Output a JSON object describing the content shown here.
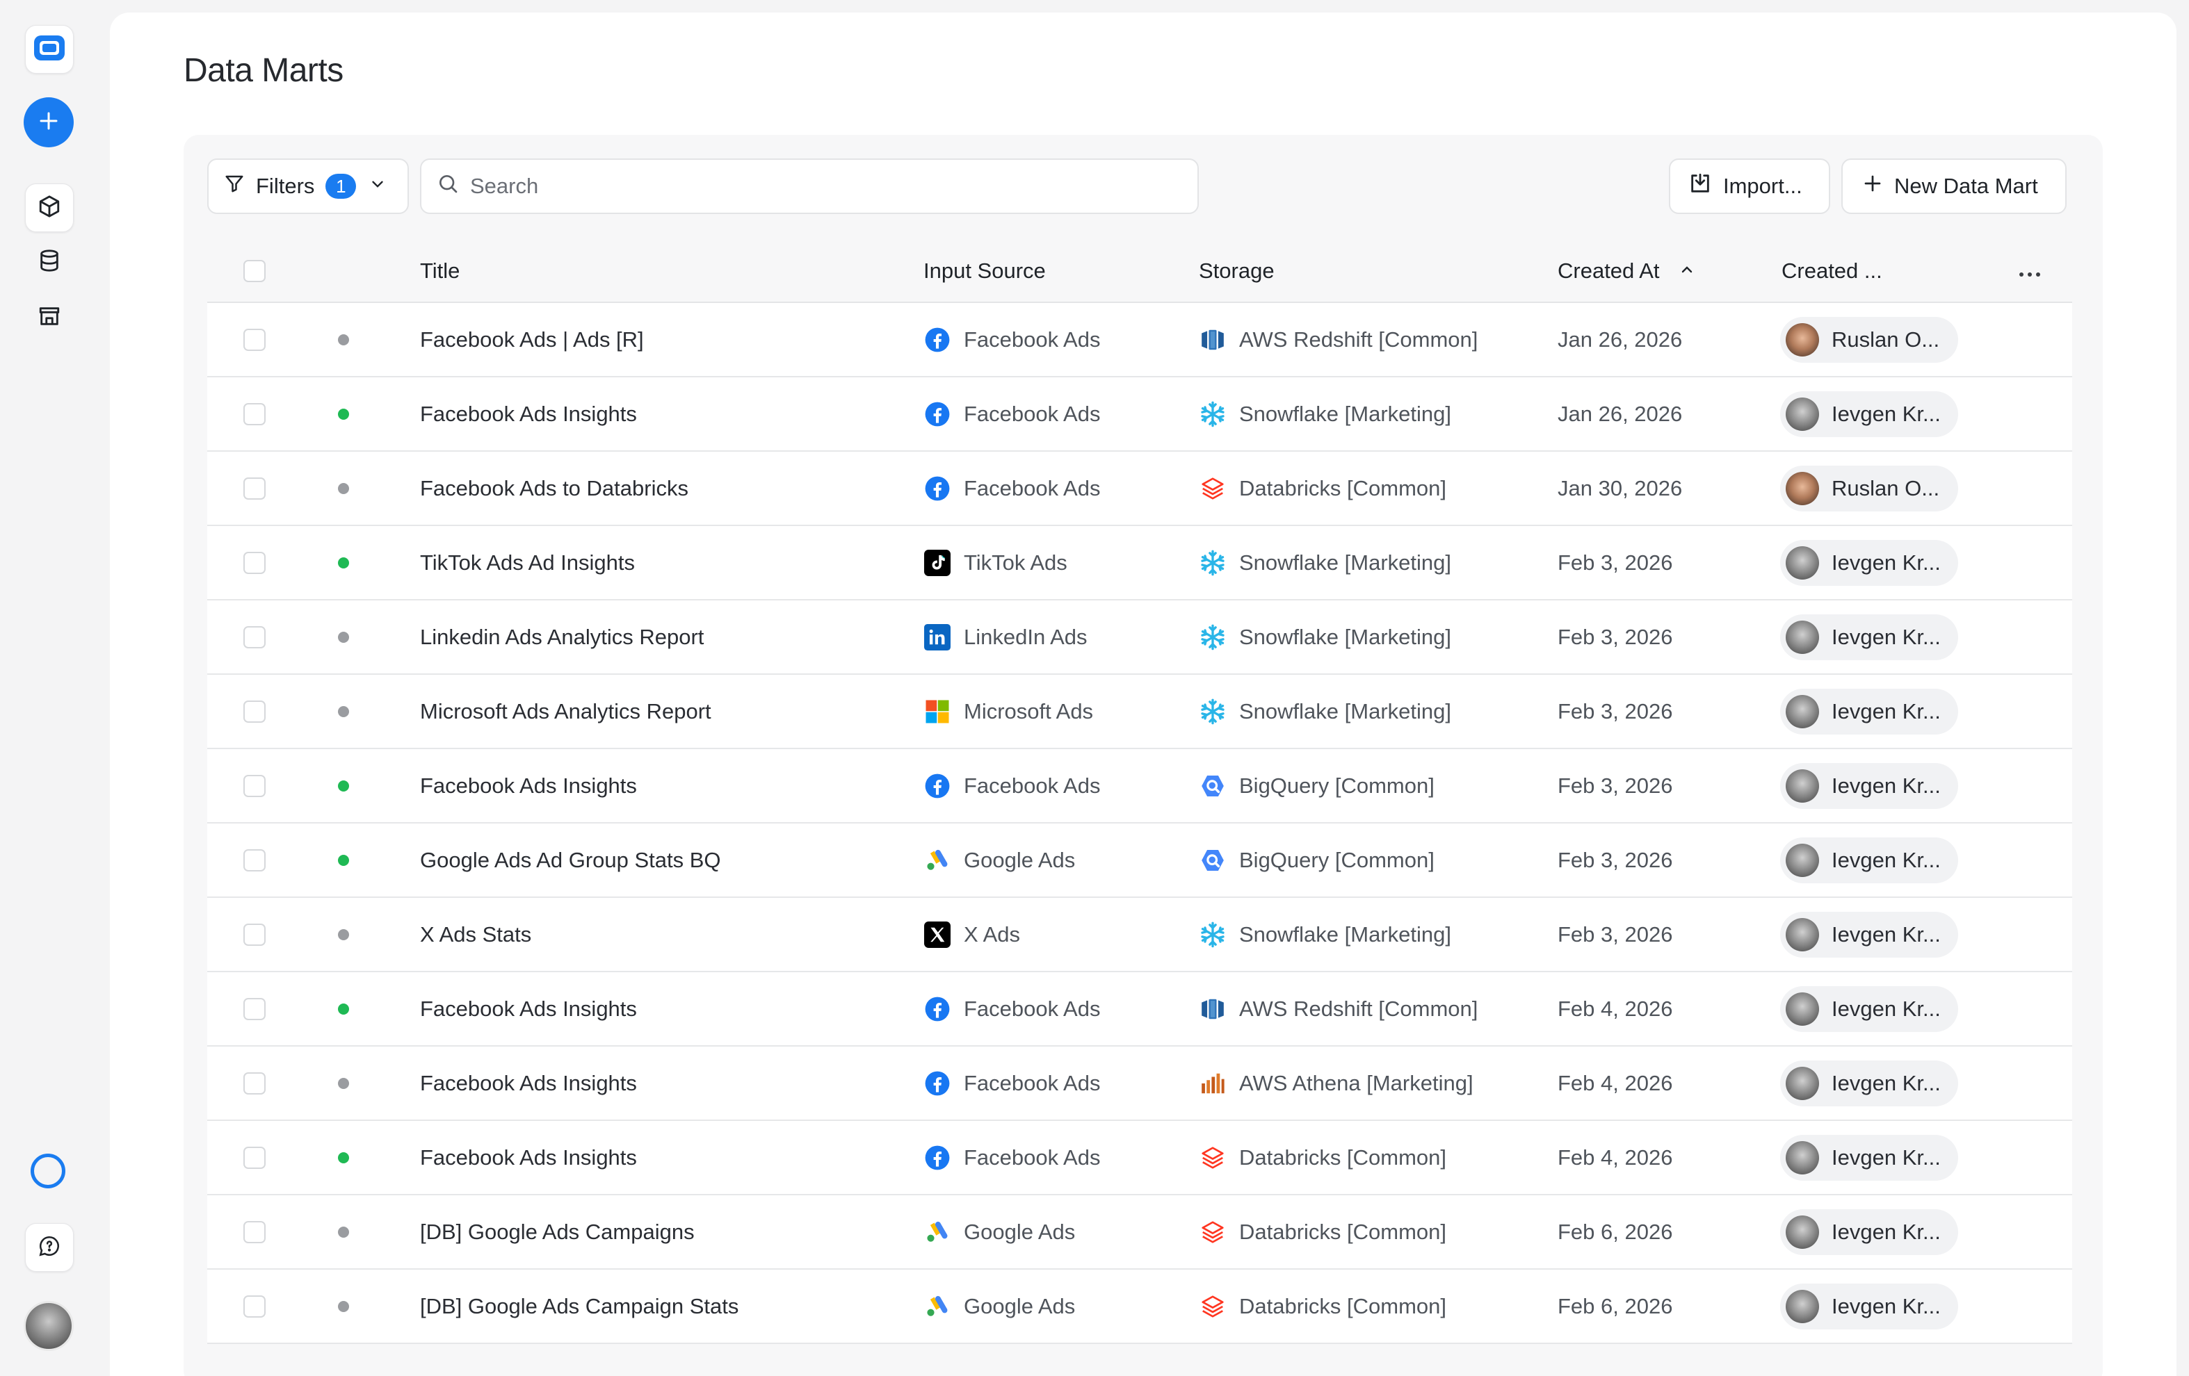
{
  "page": {
    "title": "Data Marts"
  },
  "toolbar": {
    "filters_label": "Filters",
    "filters_count": "1",
    "search_placeholder": "Search",
    "import_label": "Import...",
    "new_label": "New Data Mart"
  },
  "table": {
    "columns": {
      "title": "Title",
      "input_source": "Input Source",
      "storage": "Storage",
      "created_at": "Created At",
      "created_by": "Created ..."
    },
    "rows": [
      {
        "title": "Facebook Ads | Ads [R]",
        "status": "inactive",
        "source": "Facebook Ads",
        "source_icon": "facebook-icon",
        "storage": "AWS Redshift [Common]",
        "storage_icon": "aws-redshift-icon",
        "created_at": "Jan 26, 2026",
        "created_by": "Ruslan O..."
      },
      {
        "title": "Facebook Ads Insights",
        "status": "active",
        "source": "Facebook Ads",
        "source_icon": "facebook-icon",
        "storage": "Snowflake [Marketing]",
        "storage_icon": "snowflake-icon",
        "created_at": "Jan 26, 2026",
        "created_by": "Ievgen Kr..."
      },
      {
        "title": "Facebook Ads to Databricks",
        "status": "inactive",
        "source": "Facebook Ads",
        "source_icon": "facebook-icon",
        "storage": "Databricks [Common]",
        "storage_icon": "databricks-icon",
        "created_at": "Jan 30, 2026",
        "created_by": "Ruslan O..."
      },
      {
        "title": "TikTok Ads Ad Insights",
        "status": "active",
        "source": "TikTok Ads",
        "source_icon": "tiktok-icon",
        "storage": "Snowflake [Marketing]",
        "storage_icon": "snowflake-icon",
        "created_at": "Feb 3, 2026",
        "created_by": "Ievgen Kr..."
      },
      {
        "title": "Linkedin Ads Analytics Report",
        "status": "inactive",
        "source": "LinkedIn Ads",
        "source_icon": "linkedin-icon",
        "storage": "Snowflake [Marketing]",
        "storage_icon": "snowflake-icon",
        "created_at": "Feb 3, 2026",
        "created_by": "Ievgen Kr..."
      },
      {
        "title": "Microsoft Ads Analytics Report",
        "status": "inactive",
        "source": "Microsoft Ads",
        "source_icon": "microsoft-icon",
        "storage": "Snowflake [Marketing]",
        "storage_icon": "snowflake-icon",
        "created_at": "Feb 3, 2026",
        "created_by": "Ievgen Kr..."
      },
      {
        "title": "Facebook Ads Insights",
        "status": "active",
        "source": "Facebook Ads",
        "source_icon": "facebook-icon",
        "storage": "BigQuery [Common]",
        "storage_icon": "bigquery-icon",
        "created_at": "Feb 3, 2026",
        "created_by": "Ievgen Kr..."
      },
      {
        "title": "Google Ads Ad Group Stats BQ",
        "status": "active",
        "source": "Google Ads",
        "source_icon": "google-ads-icon",
        "storage": "BigQuery [Common]",
        "storage_icon": "bigquery-icon",
        "created_at": "Feb 3, 2026",
        "created_by": "Ievgen Kr..."
      },
      {
        "title": "X Ads Stats",
        "status": "inactive",
        "source": "X Ads",
        "source_icon": "x-icon",
        "storage": "Snowflake [Marketing]",
        "storage_icon": "snowflake-icon",
        "created_at": "Feb 3, 2026",
        "created_by": "Ievgen Kr..."
      },
      {
        "title": "Facebook Ads Insights",
        "status": "active",
        "source": "Facebook Ads",
        "source_icon": "facebook-icon",
        "storage": "AWS Redshift [Common]",
        "storage_icon": "aws-redshift-icon",
        "created_at": "Feb 4, 2026",
        "created_by": "Ievgen Kr..."
      },
      {
        "title": "Facebook Ads Insights",
        "status": "inactive",
        "source": "Facebook Ads",
        "source_icon": "facebook-icon",
        "storage": "AWS Athena [Marketing]",
        "storage_icon": "aws-athena-icon",
        "created_at": "Feb 4, 2026",
        "created_by": "Ievgen Kr..."
      },
      {
        "title": "Facebook Ads Insights",
        "status": "active",
        "source": "Facebook Ads",
        "source_icon": "facebook-icon",
        "storage": "Databricks [Common]",
        "storage_icon": "databricks-icon",
        "created_at": "Feb 4, 2026",
        "created_by": "Ievgen Kr..."
      },
      {
        "title": "[DB] Google Ads Campaigns",
        "status": "inactive",
        "source": "Google Ads",
        "source_icon": "google-ads-icon",
        "storage": "Databricks [Common]",
        "storage_icon": "databricks-icon",
        "created_at": "Feb 6, 2026",
        "created_by": "Ievgen Kr..."
      },
      {
        "title": "[DB] Google Ads Campaign Stats",
        "status": "inactive",
        "source": "Google Ads",
        "source_icon": "google-ads-icon",
        "storage": "Databricks [Common]",
        "storage_icon": "databricks-icon",
        "created_at": "Feb 6, 2026",
        "created_by": "Ievgen Kr..."
      }
    ]
  },
  "colors": {
    "accent": "#1a7cf0",
    "status_active": "#1fb954",
    "status_inactive": "#9a9ca0"
  },
  "sidebar": {
    "icons": [
      "app-logo-icon",
      "plus-icon",
      "cube-icon",
      "database-icon",
      "store-icon",
      "status-ring-icon",
      "help-chat-icon",
      "user-avatar"
    ]
  }
}
